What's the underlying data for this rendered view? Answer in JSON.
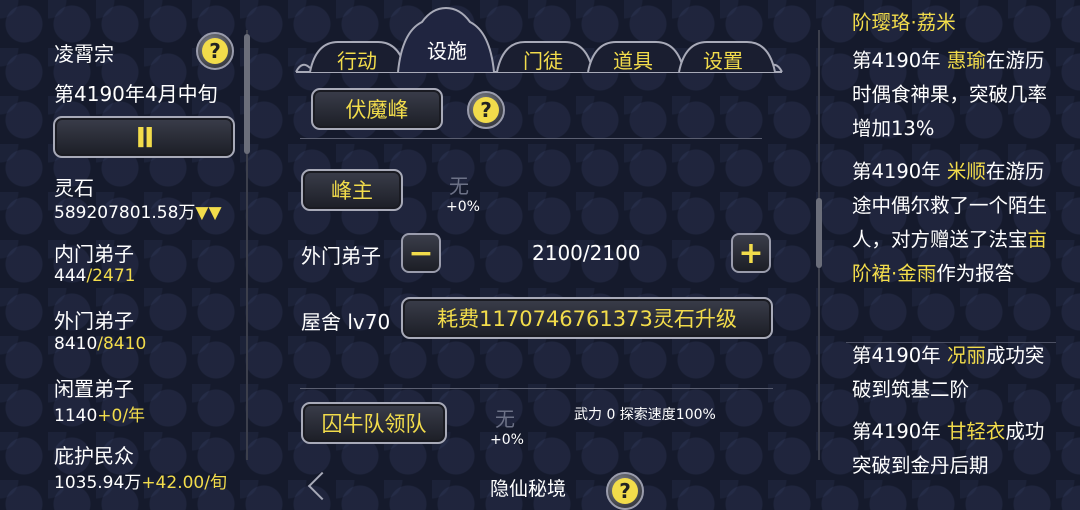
{
  "left": {
    "sect_name": "凌霄宗",
    "date": "第4190年4月中旬",
    "pause_symbol": "II",
    "stone_label": "灵石",
    "stone_value": "589207801.58万",
    "stone_trend": "▼▼",
    "inner_label": "内门弟子",
    "inner_current": "444",
    "inner_max": "/2471",
    "outer_label": "外门弟子",
    "outer_current": "8410",
    "outer_max": "/8410",
    "idle_label": "闲置弟子",
    "idle_current": "1140",
    "idle_rate": "+0/年",
    "civil_label": "庇护民众",
    "civil_current": "1035.94万",
    "civil_rate": "+42.00/旬"
  },
  "tabs": [
    {
      "label": "行动"
    },
    {
      "label": "设施"
    },
    {
      "label": "门徒"
    },
    {
      "label": "道具"
    },
    {
      "label": "设置"
    }
  ],
  "main": {
    "peak_button": "伏魔峰",
    "lord_button": "峰主",
    "lord_value": "无",
    "lord_bonus": "+0%",
    "outer_label": "外门弟子",
    "minus": "−",
    "outer_count": "2100/2100",
    "plus": "+",
    "house_label": "屋舍 lv70",
    "upgrade_button": "耗费1170746761373灵石升级",
    "team_button": "囚牛队领队",
    "team_value": "无",
    "team_bonus": "+0%",
    "team_stats": "武力  0 探索速度100%",
    "bottom_partial": "隐仙秘境"
  },
  "log": {
    "top_title": "阶璎珞·荔米",
    "entries": [
      {
        "parts": [
          {
            "t": "第4190年 ",
            "y": false
          },
          {
            "t": "惠瑜",
            "y": true
          },
          {
            "t": "在游历时偶食神果，突破几率增加13%",
            "y": false
          }
        ]
      },
      {
        "parts": [
          {
            "t": "第4190年 ",
            "y": false
          },
          {
            "t": "米顺",
            "y": true
          },
          {
            "t": "在游历途中偶尔救了一个陌生人，对方赠送了法宝",
            "y": false
          },
          {
            "t": "亩阶裙·金雨",
            "y": true
          },
          {
            "t": "作为报答",
            "y": false
          }
        ]
      },
      {
        "parts": [
          {
            "t": "第4190年 ",
            "y": false
          },
          {
            "t": "况丽",
            "y": true
          },
          {
            "t": "成功突破到筑基二阶",
            "y": false
          }
        ]
      },
      {
        "parts": [
          {
            "t": "第4190年 ",
            "y": false
          },
          {
            "t": "甘轻衣",
            "y": true
          },
          {
            "t": "成功突破到金丹后期",
            "y": false
          }
        ]
      }
    ]
  },
  "colors": {
    "accent": "#f2dc4b",
    "bg": "#151a2c",
    "border": "#a8aab8"
  }
}
